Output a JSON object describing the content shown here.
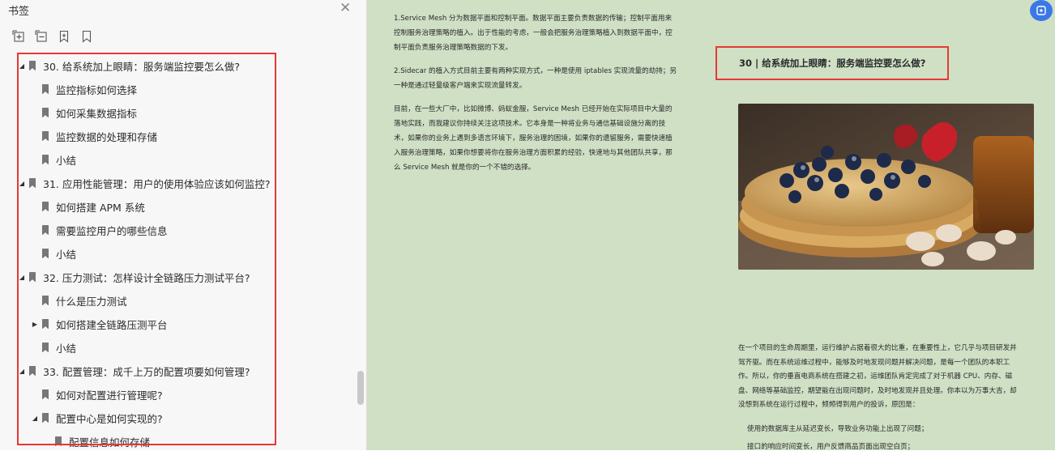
{
  "panel": {
    "title": "书签",
    "toolbar": [
      "expand-all-icon",
      "collapse-all-icon",
      "add-bookmark-icon",
      "bookmark-icon"
    ]
  },
  "bookmarks": [
    {
      "label": "30. 给系统加上眼睛：服务端监控要怎么做?",
      "level": 0,
      "state": "expanded"
    },
    {
      "label": "监控指标如何选择",
      "level": 1,
      "state": "none"
    },
    {
      "label": "如何采集数据指标",
      "level": 1,
      "state": "none"
    },
    {
      "label": "监控数据的处理和存储",
      "level": 1,
      "state": "none"
    },
    {
      "label": "小结",
      "level": 1,
      "state": "none"
    },
    {
      "label": "31. 应用性能管理：用户的使用体验应该如何监控?",
      "level": 0,
      "state": "expanded"
    },
    {
      "label": "如何搭建 APM 系统",
      "level": 1,
      "state": "none"
    },
    {
      "label": "需要监控用户的哪些信息",
      "level": 1,
      "state": "none"
    },
    {
      "label": "小结",
      "level": 1,
      "state": "none"
    },
    {
      "label": "32. 压力测试：怎样设计全链路压力测试平台?",
      "level": 0,
      "state": "expanded"
    },
    {
      "label": "什么是压力测试",
      "level": 1,
      "state": "none"
    },
    {
      "label": "如何搭建全链路压测平台",
      "level": 1,
      "state": "collapsed"
    },
    {
      "label": "小结",
      "level": 1,
      "state": "none"
    },
    {
      "label": "33. 配置管理：成千上万的配置项要如何管理?",
      "level": 0,
      "state": "expanded"
    },
    {
      "label": "如何对配置进行管理呢?",
      "level": 1,
      "state": "none"
    },
    {
      "label": "配置中心是如何实现的?",
      "level": 1,
      "state": "expanded"
    },
    {
      "label": "配置信息如何存储",
      "level": 2,
      "state": "none"
    }
  ],
  "doc": {
    "left_paras": [
      [
        "1.Service Mesh 分为数据平面和控制平面。数据平面主要负责数据的传输；控制平面用来",
        "控制服务治理策略的植入。出于性能的考虑，一般会把服务治理策略植入到数据平面中，控",
        "制平面负责服务治理策略数据的下发。"
      ],
      [
        "2.Sidecar 的植入方式目前主要有两种实现方式，一种是使用 iptables 实现流量的劫持；另",
        "一种是通过轻量级客户端来实现流量转发。"
      ],
      [
        "目前，在一些大厂中，比如微博、蚂蚁金服，Service Mesh 已经开始在实际项目中大量的",
        "落地实践，而我建议你持续关注这项技术。它本身是一种将业务与通信基础设施分离的技",
        "术，如果你的业务上遇到多语言环境下，服务治理的困境，如果你的遗留服务，需要快速植",
        "入服务治理策略，如果你想要将你在服务治理方面积累的经验，快速地与其他团队共享，那",
        "么 Service Mesh 就是你的一个不错的选择。"
      ]
    ],
    "chapter_title": "30 | 给系统加上眼睛：服务端监控要怎么做?",
    "body_lines": [
      "在一个项目的生命周期里，运行维护占据着很大的比重，在重要性上，它几乎与项目研发并",
      "驾齐驱。而在系统运维过程中，能够及时地发现问题并解决问题，是每一个团队的本职工",
      "作。所以，你的垂直电商系统在搭建之初，运维团队肯定完成了对于机器 CPU、内存、磁",
      "盘、网络等基础监控，期望能在出现问题时，及时地发现并且处理。你本以为万事大吉，却",
      "没想到系统在运行过程中，频频得到用户的投诉，原因是："
    ],
    "list_lines": [
      "使用的数据库主从延迟变长，导致业务功能上出现了问题；",
      "接口的响应时间变长，用户反馈商品页面出现空白页；"
    ]
  },
  "colors": {
    "highlight": "#e53935",
    "page_bg": "#cfe0c5",
    "share": "#3b78e7"
  }
}
